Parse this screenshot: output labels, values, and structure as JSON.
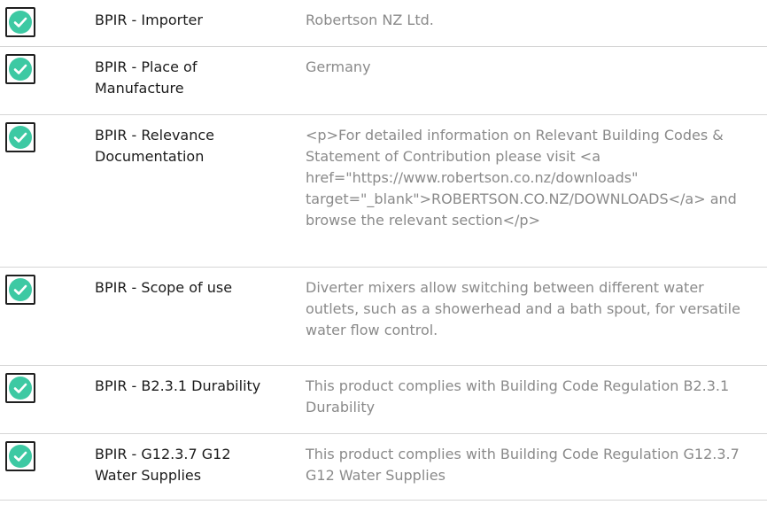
{
  "colors": {
    "check_fill": "#3dc9a3",
    "check_border": "#1f1f1f",
    "label_text": "#1b1b1b",
    "value_text": "#8a8a8a",
    "divider": "#d6d6d6"
  },
  "rows": [
    {
      "icon": "checkmark-icon",
      "label": "BPIR - Importer",
      "value": "Robertson NZ Ltd."
    },
    {
      "icon": "checkmark-icon",
      "label": "BPIR - Place of Manufacture",
      "value": "Germany"
    },
    {
      "icon": "checkmark-icon",
      "label": "BPIR - Relevance Documentation",
      "value": "<p>For detailed information on Relevant Building Codes & Statement of Contribution please visit <a href=\"https://www.robertson.co.nz/downloads\" target=\"_blank\">ROBERTSON.CO.NZ/DOWNLOADS</a> and browse the relevant section</p>"
    },
    {
      "icon": "checkmark-icon",
      "label": "BPIR - Scope of use",
      "value": "Diverter mixers allow switching between different water outlets, such as a showerhead and a bath spout, for versatile water flow control."
    },
    {
      "icon": "checkmark-icon",
      "label": "BPIR - B2.3.1 Durability",
      "value": "This product complies with Building Code Regulation B2.3.1 Durability"
    },
    {
      "icon": "checkmark-icon",
      "label": "BPIR - G12.3.7 G12 Water Supplies",
      "value": "This product complies with Building Code Regulation G12.3.7 G12 Water Supplies"
    }
  ]
}
